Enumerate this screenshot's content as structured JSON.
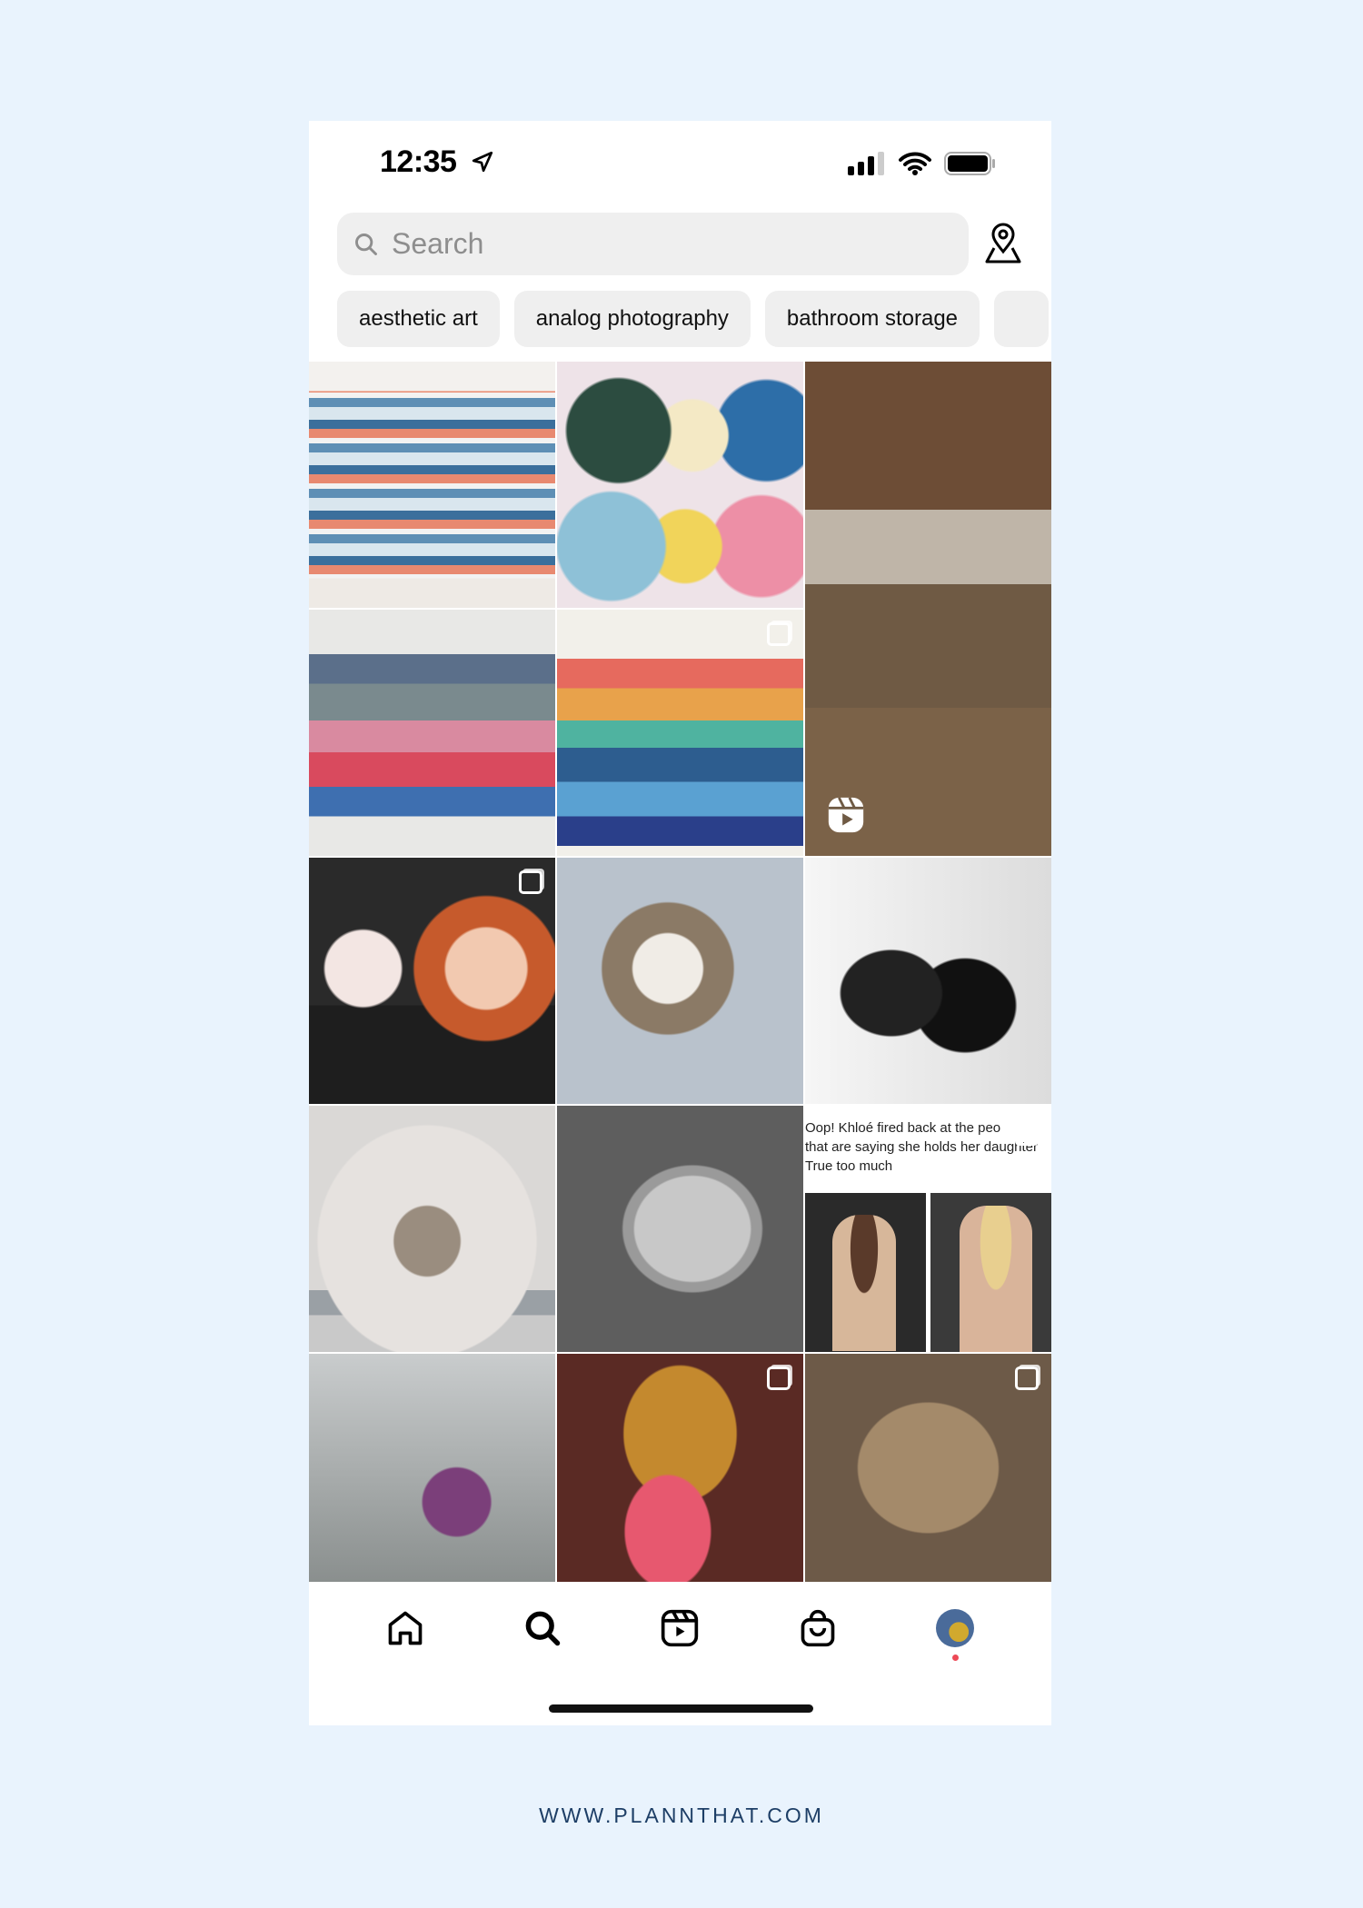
{
  "status_bar": {
    "time": "12:35"
  },
  "search": {
    "placeholder": "Search"
  },
  "chips": [
    "aesthetic art",
    "analog photography",
    "bathroom storage"
  ],
  "grid": {
    "tiles": [
      {
        "subject": "stack of books",
        "multi": false
      },
      {
        "subject": "books on table",
        "multi": false
      },
      {
        "subject": "person in garden venue",
        "type": "reel"
      },
      {
        "subject": "book page count stack",
        "multi": false
      },
      {
        "subject": "book quotes stack",
        "multi": true
      },
      {
        "subject": "face paint costume",
        "multi": true
      },
      {
        "subject": "kittens on rug",
        "multi": false
      },
      {
        "subject": "black and white couple",
        "multi": false
      },
      {
        "subject": "sleeping kitten",
        "multi": false
      },
      {
        "subject": "grey kitten",
        "multi": false
      },
      {
        "subject": "tweet with photos",
        "multi": true,
        "tweet_lines": [
          "Oop! Khloé fired back at the peo",
          "that are saying she holds her daughter",
          "True too much"
        ]
      },
      {
        "subject": "zip line",
        "multi": false
      },
      {
        "subject": "orange cat and cookie",
        "multi": true
      },
      {
        "subject": "tabby cat closeup",
        "multi": true
      }
    ]
  },
  "nav": {
    "items": [
      "home",
      "search",
      "reels",
      "shop",
      "profile"
    ],
    "active": "search",
    "notification_dot_color": "#ed4956"
  },
  "footer": {
    "text": "WWW.PLANNTHAT.COM"
  },
  "colors": {
    "background": "#e9f3fd",
    "footer": "#1d3e66"
  }
}
